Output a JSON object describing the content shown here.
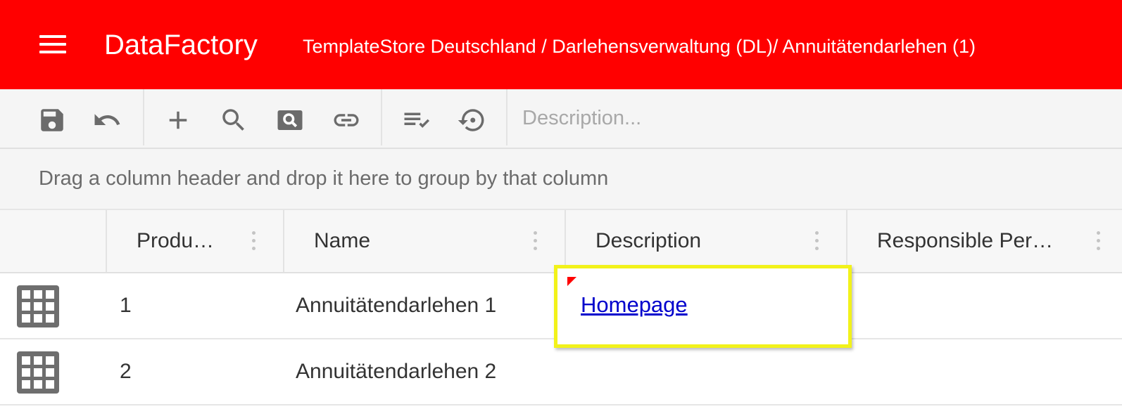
{
  "header": {
    "app_title": "DataFactory",
    "breadcrumb": "TemplateStore Deutschland / Darlehensverwaltung (DL)/ Annuitätendarlehen (1)",
    "background_color": "#ff0000"
  },
  "toolbar": {
    "buttons": [
      "save-icon",
      "undo-icon",
      "add-icon",
      "search-icon",
      "search-box-icon",
      "link-icon",
      "checklist-icon",
      "history-icon"
    ],
    "description_placeholder": "Description...",
    "description_value": ""
  },
  "group_panel": {
    "text": "Drag a column header and drop it here to group by that column"
  },
  "grid": {
    "columns": [
      "Produ…",
      "Name",
      "Description",
      "Responsible Per…"
    ],
    "rows": [
      {
        "id": "1",
        "name": "Annuitätendarlehen 1",
        "description": "Homepage",
        "responsible": ""
      },
      {
        "id": "2",
        "name": "Annuitätendarlehen 2",
        "description": "",
        "responsible": ""
      }
    ],
    "highlight_color": "#f2f21a",
    "link_color": "#0000cc"
  }
}
